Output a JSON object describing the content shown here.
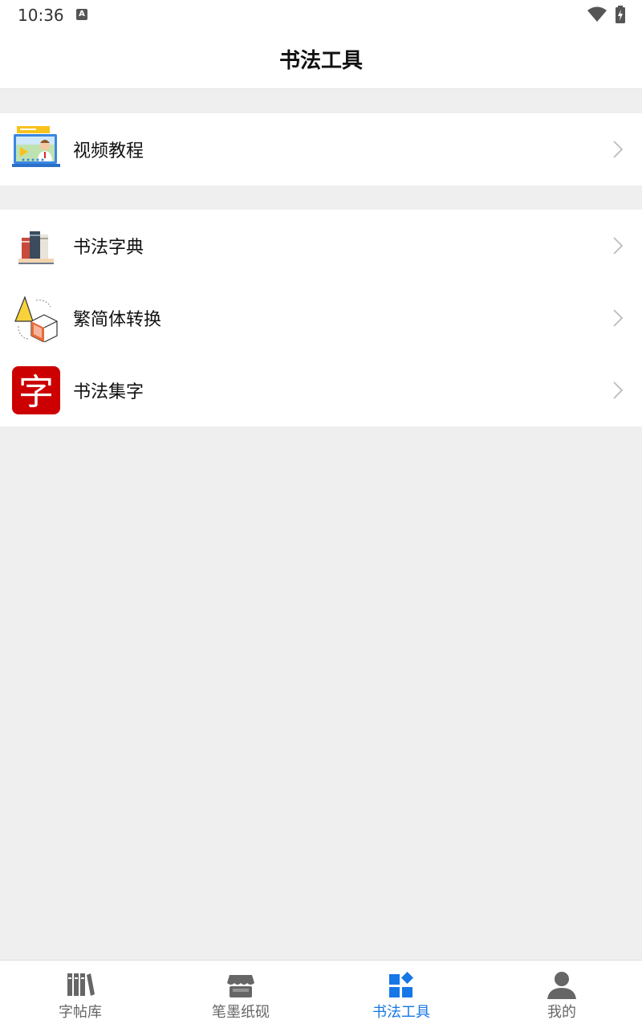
{
  "status_bar": {
    "time": "10:36",
    "notification_icon": "A",
    "icons": [
      "wifi-icon",
      "battery-charging-icon"
    ]
  },
  "header": {
    "title": "书法工具"
  },
  "groups": [
    {
      "items": [
        {
          "label": "视频教程",
          "icon": "video-tutorial-icon"
        }
      ]
    },
    {
      "items": [
        {
          "label": "书法字典",
          "icon": "books-icon"
        },
        {
          "label": "繁简体转换",
          "icon": "shape-convert-icon"
        },
        {
          "label": "书法集字",
          "icon": "zi-character-icon",
          "icon_text": "字"
        }
      ]
    }
  ],
  "bottom_nav": {
    "items": [
      {
        "label": "字帖库",
        "icon": "bookshelf-icon",
        "active": false
      },
      {
        "label": "笔墨纸砚",
        "icon": "store-icon",
        "active": false
      },
      {
        "label": "书法工具",
        "icon": "apps-grid-icon",
        "active": true
      },
      {
        "label": "我的",
        "icon": "person-icon",
        "active": false
      }
    ]
  },
  "colors": {
    "accent": "#1677e6",
    "background": "#efefef",
    "inactive_nav": "#666666",
    "zi_red": "#cc0000"
  }
}
